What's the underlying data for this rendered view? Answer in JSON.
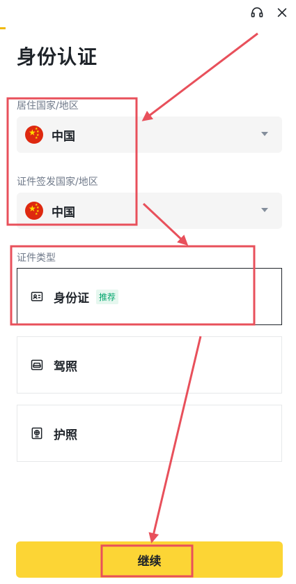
{
  "header": {
    "support_icon": "headset-icon",
    "close_icon": "close-icon"
  },
  "page": {
    "title": "身份认证"
  },
  "residence": {
    "label": "居住国家/地区",
    "value": "中国",
    "flag": "china-flag-icon"
  },
  "issuing": {
    "label": "证件签发国家/地区",
    "value": "中国",
    "flag": "china-flag-icon"
  },
  "document_type": {
    "label": "证件类型",
    "options": [
      {
        "label": "身份证",
        "badge": "推荐",
        "icon": "id-card-icon",
        "selected": true
      },
      {
        "label": "驾照",
        "badge": "",
        "icon": "car-icon",
        "selected": false
      },
      {
        "label": "护照",
        "badge": "",
        "icon": "passport-icon",
        "selected": false
      }
    ]
  },
  "footer": {
    "continue_label": "继续"
  },
  "colors": {
    "brand_yellow": "#fcd535",
    "accent": "#f0b90b",
    "annotation_red": "#e8505b",
    "badge_green": "#03a66d"
  }
}
